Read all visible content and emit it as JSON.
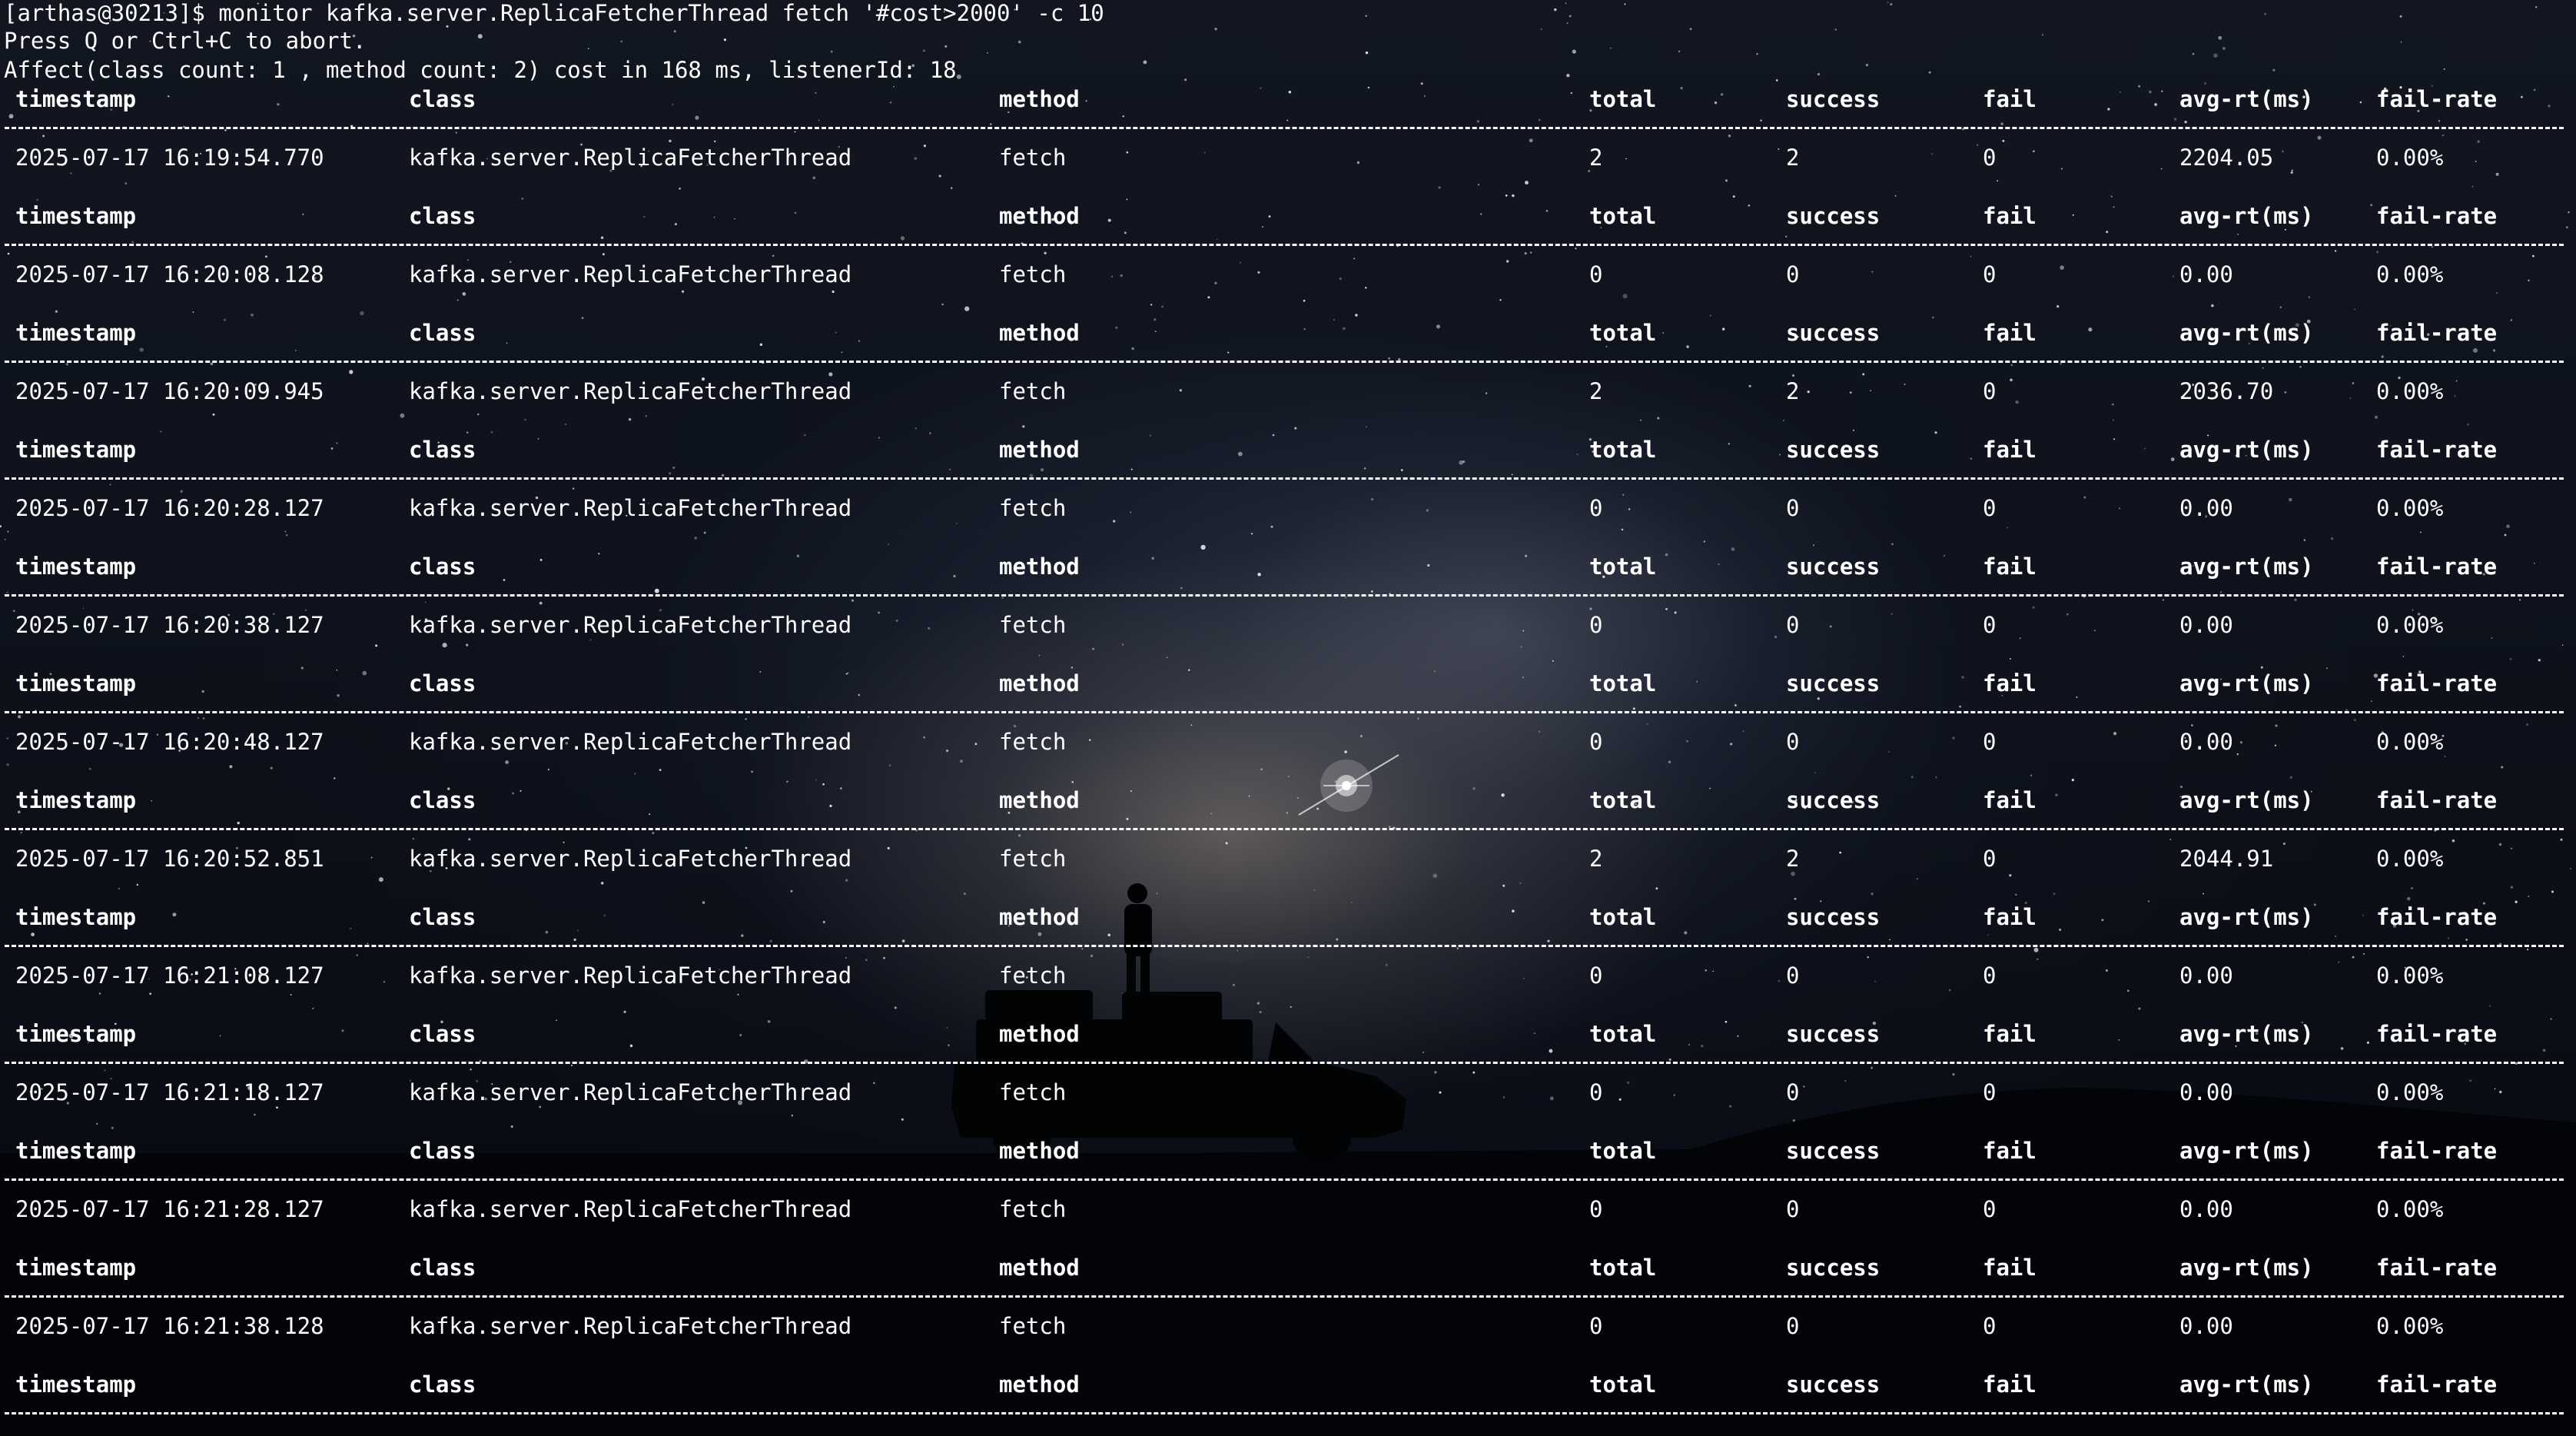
{
  "terminal": {
    "prompt_line": "[arthas@30213]$ monitor kafka.server.ReplicaFetcherThread fetch '#cost>2000' -c 10",
    "abort_line": "Press Q or Ctrl+C to abort.",
    "affect_line": "Affect(class count: 1 , method count: 2) cost in 168 ms, listenerId: 18"
  },
  "table": {
    "headers": {
      "timestamp": "timestamp",
      "class": "class",
      "method": "method",
      "total": "total",
      "success": "success",
      "fail": "fail",
      "avg_rt": "avg-rt(ms)",
      "fail_rate": "fail-rate"
    },
    "rows": [
      {
        "timestamp": "2025-07-17 16:19:54.770",
        "class": "kafka.server.ReplicaFetcherThread",
        "method": "fetch",
        "total": "2",
        "success": "2",
        "fail": "0",
        "avg_rt": "2204.05",
        "fail_rate": "0.00%"
      },
      {
        "timestamp": "2025-07-17 16:20:08.128",
        "class": "kafka.server.ReplicaFetcherThread",
        "method": "fetch",
        "total": "0",
        "success": "0",
        "fail": "0",
        "avg_rt": "0.00",
        "fail_rate": "0.00%"
      },
      {
        "timestamp": "2025-07-17 16:20:09.945",
        "class": "kafka.server.ReplicaFetcherThread",
        "method": "fetch",
        "total": "2",
        "success": "2",
        "fail": "0",
        "avg_rt": "2036.70",
        "fail_rate": "0.00%"
      },
      {
        "timestamp": "2025-07-17 16:20:28.127",
        "class": "kafka.server.ReplicaFetcherThread",
        "method": "fetch",
        "total": "0",
        "success": "0",
        "fail": "0",
        "avg_rt": "0.00",
        "fail_rate": "0.00%"
      },
      {
        "timestamp": "2025-07-17 16:20:38.127",
        "class": "kafka.server.ReplicaFetcherThread",
        "method": "fetch",
        "total": "0",
        "success": "0",
        "fail": "0",
        "avg_rt": "0.00",
        "fail_rate": "0.00%"
      },
      {
        "timestamp": "2025-07-17 16:20:48.127",
        "class": "kafka.server.ReplicaFetcherThread",
        "method": "fetch",
        "total": "0",
        "success": "0",
        "fail": "0",
        "avg_rt": "0.00",
        "fail_rate": "0.00%"
      },
      {
        "timestamp": "2025-07-17 16:20:52.851",
        "class": "kafka.server.ReplicaFetcherThread",
        "method": "fetch",
        "total": "2",
        "success": "2",
        "fail": "0",
        "avg_rt": "2044.91",
        "fail_rate": "0.00%"
      },
      {
        "timestamp": "2025-07-17 16:21:08.127",
        "class": "kafka.server.ReplicaFetcherThread",
        "method": "fetch",
        "total": "0",
        "success": "0",
        "fail": "0",
        "avg_rt": "0.00",
        "fail_rate": "0.00%"
      },
      {
        "timestamp": "2025-07-17 16:21:18.127",
        "class": "kafka.server.ReplicaFetcherThread",
        "method": "fetch",
        "total": "0",
        "success": "0",
        "fail": "0",
        "avg_rt": "0.00",
        "fail_rate": "0.00%"
      },
      {
        "timestamp": "2025-07-17 16:21:28.127",
        "class": "kafka.server.ReplicaFetcherThread",
        "method": "fetch",
        "total": "0",
        "success": "0",
        "fail": "0",
        "avg_rt": "0.00",
        "fail_rate": "0.00%"
      },
      {
        "timestamp": "2025-07-17 16:21:38.128",
        "class": "kafka.server.ReplicaFetcherThread",
        "method": "fetch",
        "total": "0",
        "success": "0",
        "fail": "0",
        "avg_rt": "0.00",
        "fail_rate": "0.00%"
      }
    ]
  },
  "colors": {
    "text": "#ffffff",
    "background": "#0b0f17"
  },
  "icons": {
    "background": "night-sky-wallpaper-icon"
  }
}
